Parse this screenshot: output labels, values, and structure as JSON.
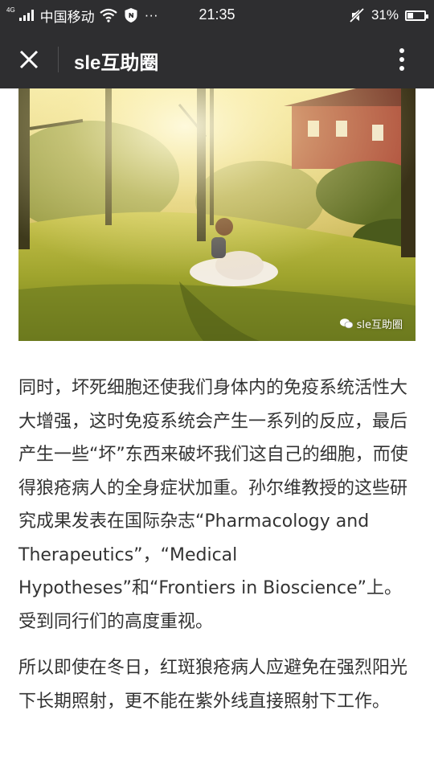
{
  "status_bar": {
    "network_type": "4G",
    "carrier": "中国移动",
    "more": "···",
    "time": "21:35",
    "battery_percent": "31%",
    "battery_level": 0.31,
    "icons": [
      "signal-icon",
      "wifi-icon",
      "shield-icon",
      "mute-icon",
      "battery-icon"
    ]
  },
  "header": {
    "title": "sle互助圈",
    "close_icon": "close-icon",
    "more_icon": "more-vertical-icon"
  },
  "hero_image": {
    "watermark": "sle互助圈"
  },
  "article": {
    "paragraphs": [
      "同时，坏死细胞还使我们身体内的免疫系统活性大大增强，这时免疫系统会产生一系列的反应，最后产生一些“坏”东西来破坏我们这自己的细胞，而使得狼疮病人的全身症状加重。孙尔维教授的这些研究成果发表在国际杂志“Pharmacology and Therapeutics”，“Medical Hypotheses”和“Frontiers in Bioscience”上。受到同行们的高度重视。",
      "所以即使在冬日，红斑狼疮病人应避免在强烈阳光下长期照射，更不能在紫外线直接照射下工作。"
    ]
  },
  "colors": {
    "bar_background": "#2e2e30",
    "text": "#333333",
    "page": "#ffffff"
  }
}
